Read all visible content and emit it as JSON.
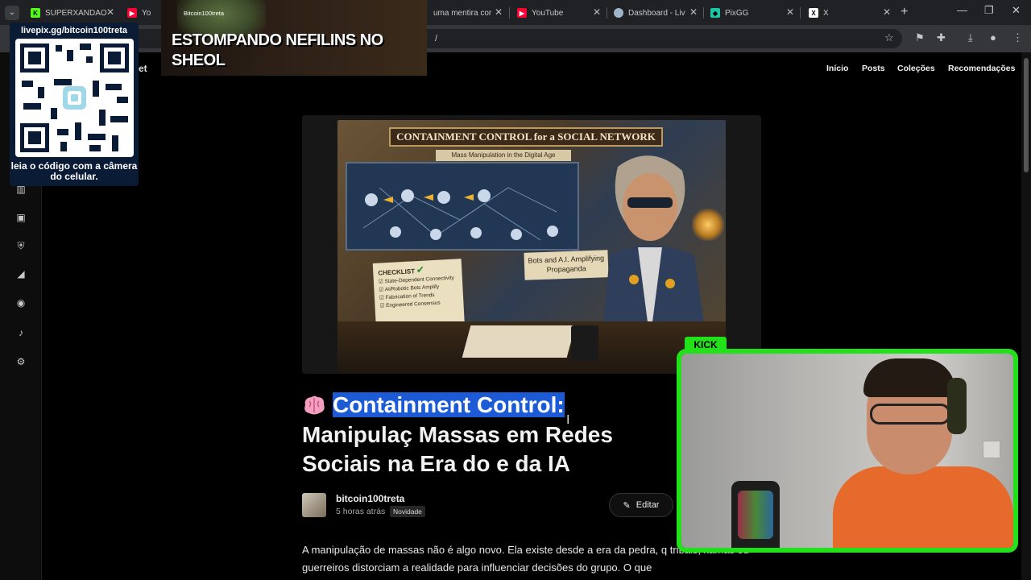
{
  "browser": {
    "tabs": [
      {
        "label": "SUPERXANDAO",
        "favicon": "kick-icon",
        "color": "#53fc18"
      },
      {
        "label": "Yo",
        "favicon": "youtube-icon",
        "color": "#ff0033"
      },
      {
        "label": "uma mentira cor",
        "favicon": "page-icon",
        "color": "#888888"
      },
      {
        "label": "YouTube",
        "favicon": "youtube-icon",
        "color": "#ff0033"
      },
      {
        "label": "Dashboard - Liv",
        "favicon": "livepix-icon",
        "color": "#9fb6c8"
      },
      {
        "label": "PixGG",
        "favicon": "pixgg-icon",
        "color": "#18c8a8"
      },
      {
        "label": "X",
        "favicon": "x-icon",
        "color": "#ffffff"
      }
    ],
    "url_fragment": "/"
  },
  "site": {
    "brand_fragment": "et",
    "nav": [
      "Início",
      "Posts",
      "Coleções",
      "Recomendações"
    ]
  },
  "hero": {
    "banner": "CONTAINMENT CONTROL for a SOCIAL NETWORK",
    "subtitle": "Mass Manipulation in the Digital Age",
    "card": "Bots and A.I. Amplifying Propaganda",
    "checklist_title": "CHECKLIST",
    "checklist_items": [
      "State-Dependent Connectivity",
      "AI/Robotic Bots Amplify",
      "Fabrication of Trends",
      "Engineered Consensus"
    ]
  },
  "post": {
    "title_highlight": "Containment Control:",
    "title_rest": " Manipulaç Massas em Redes Sociais na Era do e da IA",
    "author": "bitcoin100treta",
    "time": "5 horas atrás",
    "badge": "Novidade",
    "edit_label": "Editar",
    "body": "A manipulação de massas não é algo novo. Ela existe desde a era da pedra, q tribais, xamãs ou guerreiros distorciam a realidade para influenciar decisões do grupo. O que"
  },
  "overlay": {
    "qr_url": "livepix.gg/bitcoin100treta",
    "qr_caption": "leia o código com a câmera do celular.",
    "stream_handle": "Bitcoin100treta",
    "stream_title": "ESTOMPANDO NEFILINS NO SHEOL",
    "cam_platform": "KICK",
    "cam_border_color": "#22e01a"
  }
}
